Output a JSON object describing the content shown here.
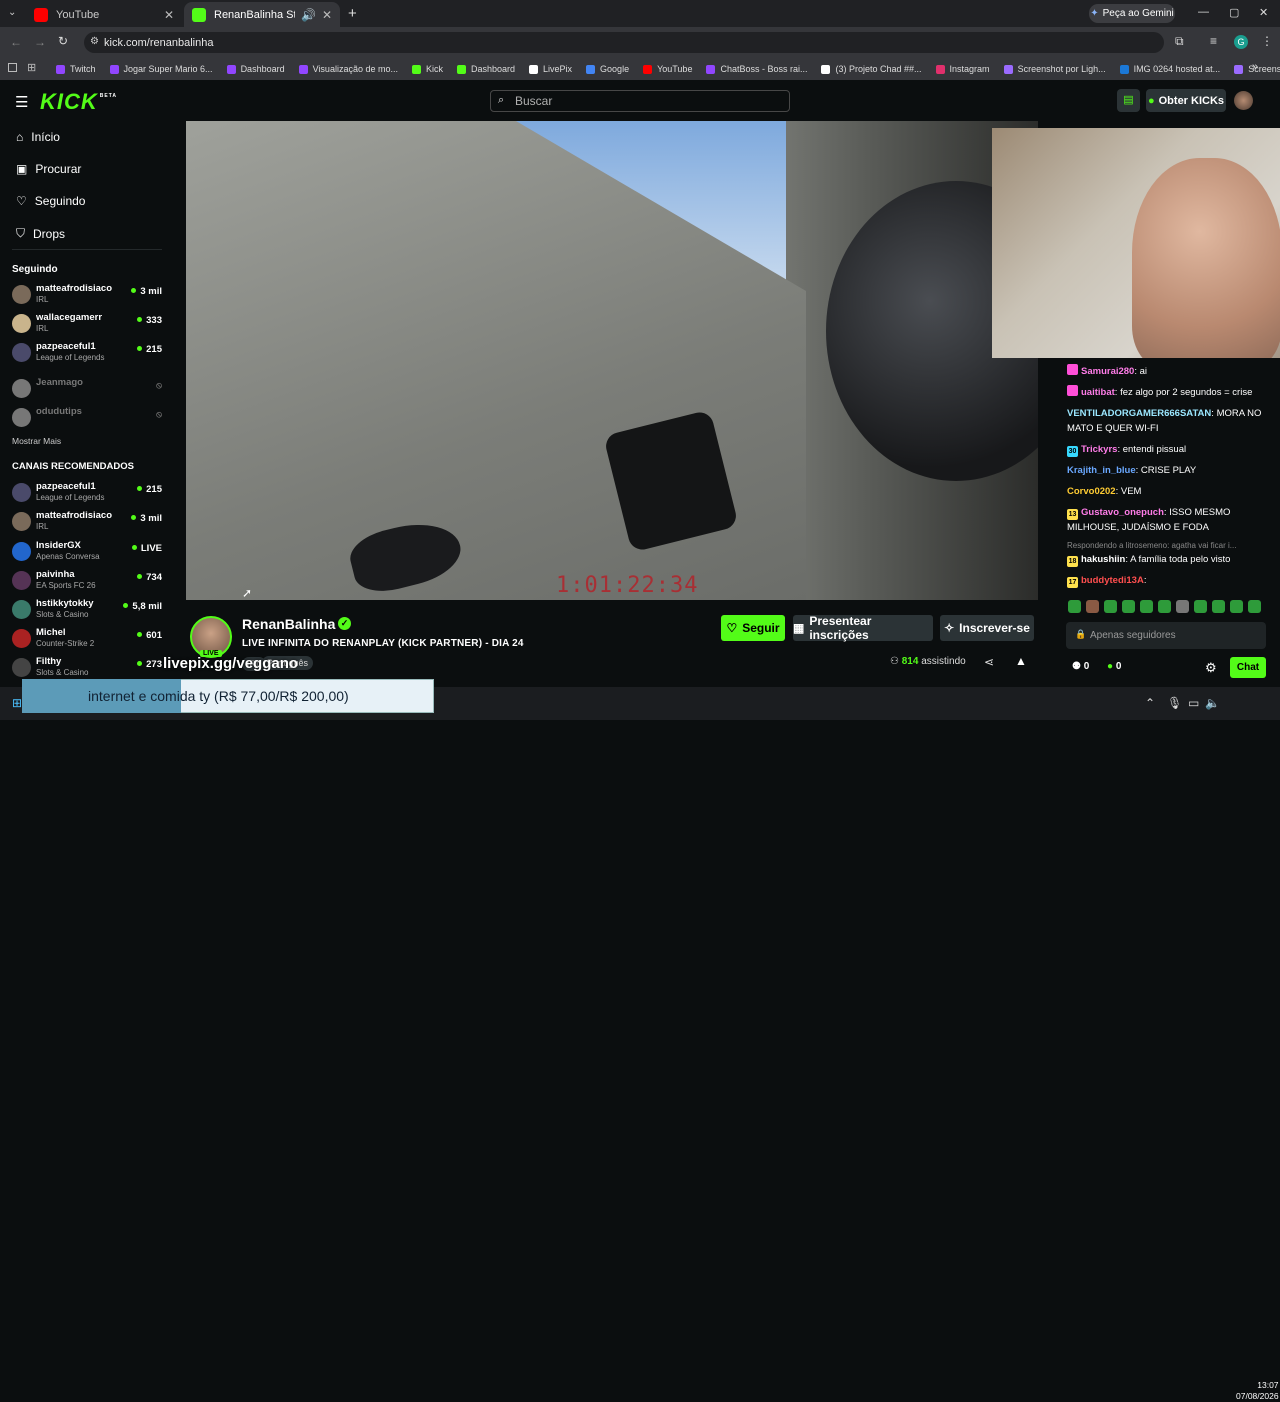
{
  "browser": {
    "tabs": [
      {
        "title": "YouTube",
        "favicon_color": "#ff0000"
      },
      {
        "title": "RenanBalinha Stream - Wat",
        "favicon_color": "#53fc18"
      }
    ],
    "gemini_label": "Peça ao Gemini",
    "url": "kick.com/renanbalinha",
    "profile_initial": "G",
    "bookmarks": [
      {
        "label": "Twitch",
        "color": "#9146ff"
      },
      {
        "label": "Jogar Super Mario 6...",
        "color": "#9146ff"
      },
      {
        "label": "Dashboard",
        "color": "#9146ff"
      },
      {
        "label": "Visualização de mo...",
        "color": "#9146ff"
      },
      {
        "label": "Kick",
        "color": "#53fc18"
      },
      {
        "label": "Dashboard",
        "color": "#53fc18"
      },
      {
        "label": "LivePix",
        "color": "#ffffff"
      },
      {
        "label": "Google",
        "color": "#4285f4"
      },
      {
        "label": "YouTube",
        "color": "#ff0000"
      },
      {
        "label": "ChatBoss - Boss rai...",
        "color": "#9146ff"
      },
      {
        "label": "(3) Projeto Chad ##...",
        "color": "#ffffff"
      },
      {
        "label": "Instagram",
        "color": "#e1306c"
      },
      {
        "label": "Screenshot por Ligh...",
        "color": "#9b6bff"
      },
      {
        "label": "IMG 0264 hosted at...",
        "color": "#1b78d6"
      },
      {
        "label": "Screenshot por Ligh...",
        "color": "#9b6bff"
      }
    ]
  },
  "header": {
    "logo": "KICK",
    "logo_beta": "BETA",
    "search_placeholder": "Buscar",
    "kicks_button": "Obter KICKs"
  },
  "sidebar": {
    "nav": [
      {
        "label": "Início",
        "icon": "home-icon"
      },
      {
        "label": "Procurar",
        "icon": "browse-icon"
      },
      {
        "label": "Seguindo",
        "icon": "heart-icon"
      },
      {
        "label": "Drops",
        "icon": "drops-icon"
      }
    ],
    "following_header": "Seguindo",
    "following": [
      {
        "name": "matteafrodisiaco",
        "category": "IRL",
        "viewers": "3 mil",
        "online": true,
        "color": "#7a6a5a"
      },
      {
        "name": "wallacegamerr",
        "category": "IRL",
        "viewers": "333",
        "online": true,
        "color": "#c9b48c"
      },
      {
        "name": "pazpeaceful1",
        "category": "League of Legends",
        "viewers": "215",
        "online": true,
        "color": "#4a4a6a"
      },
      {
        "name": "Jeanmago",
        "category": "",
        "viewers": "",
        "online": false,
        "color": "#777"
      },
      {
        "name": "odudutips",
        "category": "",
        "viewers": "",
        "online": false,
        "color": "#777"
      }
    ],
    "show_more": "Mostrar Mais",
    "recommended_header": "CANAIS RECOMENDADOS",
    "recommended": [
      {
        "name": "pazpeaceful1",
        "category": "League of Legends",
        "viewers": "215",
        "color": "#4a4a6a"
      },
      {
        "name": "matteafrodisiaco",
        "category": "IRL",
        "viewers": "3 mil",
        "color": "#7a6a5a"
      },
      {
        "name": "InsiderGX",
        "category": "Apenas Conversa",
        "viewers": "LIVE",
        "color": "#2266cc"
      },
      {
        "name": "paivinha",
        "category": "EA Sports FC 26",
        "viewers": "734",
        "color": "#553355"
      },
      {
        "name": "hstikkytokky",
        "category": "Slots & Casino",
        "viewers": "5,8 mil",
        "color": "#3a7a6a"
      },
      {
        "name": "Michel",
        "category": "Counter-Strike 2",
        "viewers": "601",
        "color": "#aa2222"
      },
      {
        "name": "Filthy",
        "category": "Slots & Casino",
        "viewers": "273",
        "color": "#444"
      }
    ]
  },
  "video": {
    "timer_overlay": "1:01:22:34"
  },
  "stream": {
    "streamer": "RenanBalinha",
    "live_badge": "LIVE",
    "title": "LIVE INFINITA DO RENANPLAY (KICK PARTNER) - DIA 24",
    "tags": [
      "IRL",
      "Português"
    ],
    "follow_label": "Seguir",
    "gift_label": "Presentear inscrições",
    "subscribe_label": "Inscrever-se",
    "viewers": "814",
    "viewers_suffix": "assistindo"
  },
  "chat": {
    "messages": [
      {
        "user": "Samurai280",
        "text": "ai",
        "color": "#ff7de9",
        "badge": "",
        "badge_color": "#ff4fd8"
      },
      {
        "user": "uaitibat",
        "text": "fez algo por 2 segundos = crise",
        "color": "#ff7de9",
        "badge": "",
        "badge_color": "#ff4fd8"
      },
      {
        "user": "VENTILADORGAMER666SATAN",
        "text": "MORA NO MATO E QUER WI-FI",
        "color": "#9be7ff",
        "badge": "",
        "badge_color": ""
      },
      {
        "user": "Trickyrs",
        "text": "entendi pissual",
        "color": "#ff7de9",
        "badge": "30",
        "badge_color": "#37d9ff"
      },
      {
        "user": "Krajith_in_blue",
        "text": "CRISE PLAY",
        "color": "#6aa8ff",
        "badge": "",
        "badge_color": ""
      },
      {
        "user": "Corvo0202",
        "text": "VEM",
        "color": "#ffcc33",
        "badge": "",
        "badge_color": ""
      },
      {
        "user": "Gustavo_onepuch",
        "text": "ISSO MESMO MILHOUSE, JUDAÍSMO E FODA",
        "color": "#ff7de9",
        "badge": "13",
        "badge_color": "#ffe14d"
      },
      {
        "user": "hakushiin",
        "text": "A família toda pelo visto",
        "color": "#ffffff",
        "badge": "18",
        "badge_color": "#ffe14d",
        "reply": "Respondendo a litrosemeno: agatha vai ficar i..."
      },
      {
        "user": "buddytedi13A",
        "text": "",
        "color": "#ff4f4f",
        "badge": "17",
        "badge_color": "#ffe14d"
      }
    ],
    "input_placeholder": "Apenas seguidores",
    "points_a": "0",
    "points_b": "0",
    "chat_button": "Chat"
  },
  "overlay": {
    "livepix": "livepix.gg/veggano",
    "goal_text": "internet e comida ty (R$ 77,00/R$ 200,00)",
    "goal_fraction": 0.385
  },
  "taskbar": {
    "time": "13:07",
    "date": "07/08/2026"
  }
}
